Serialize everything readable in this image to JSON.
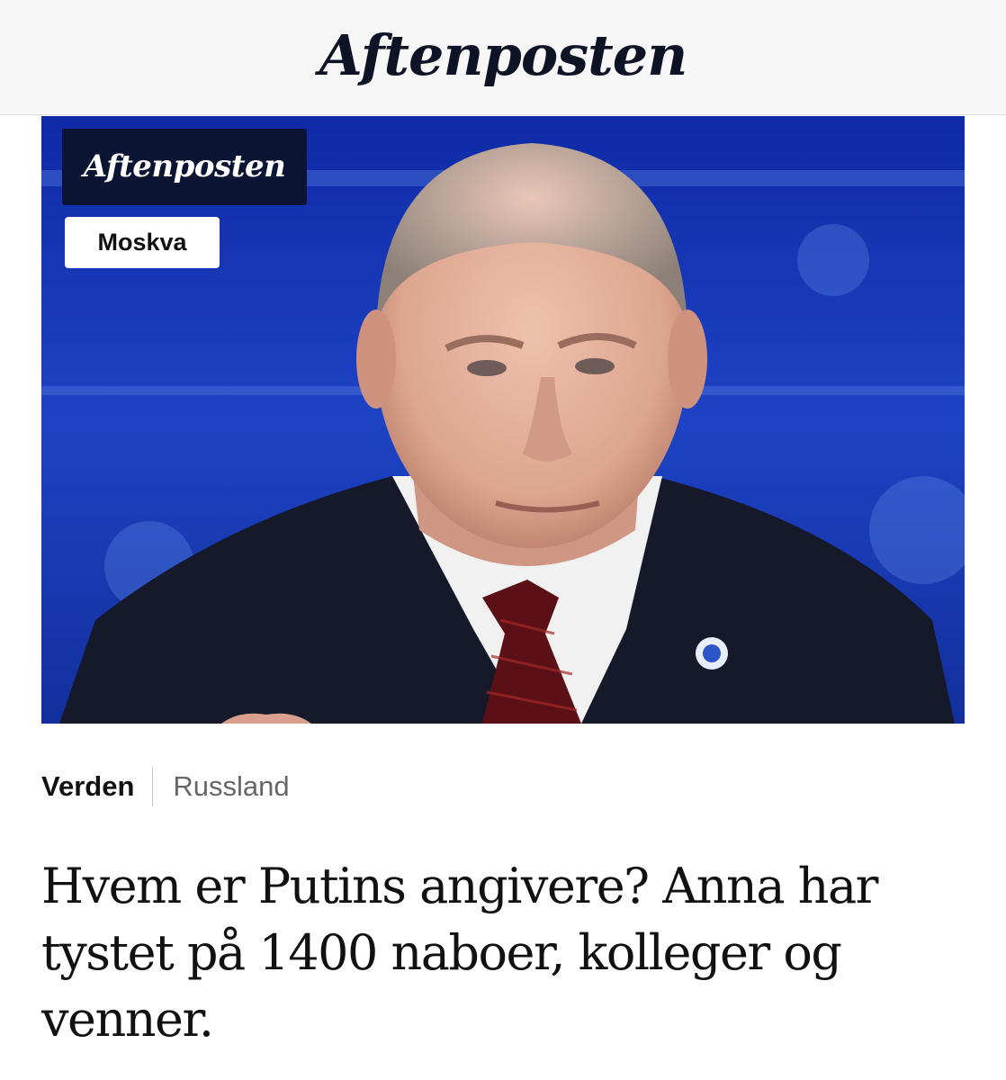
{
  "header": {
    "masthead": "Aftenposten"
  },
  "hero": {
    "badge_logo": "Aftenposten",
    "location_label": "Moskva",
    "colors": {
      "background": "#1530a8",
      "suit": "#15192a",
      "shirt": "#f1f1f1",
      "tie": "#5a1014",
      "skin": "#e4b09e"
    }
  },
  "article": {
    "section": "Verden",
    "subsection": "Russland",
    "headline": "Hvem er Putins angivere? Anna har tystet på 1400 naboer, kolleger og venner."
  },
  "colors": {
    "header_bg": "#f7f7f7",
    "brand_dark": "#0c1433",
    "text": "#111111",
    "muted": "#666666"
  },
  "icons": {
    "lapel_pin": "lapel-pin-icon"
  }
}
